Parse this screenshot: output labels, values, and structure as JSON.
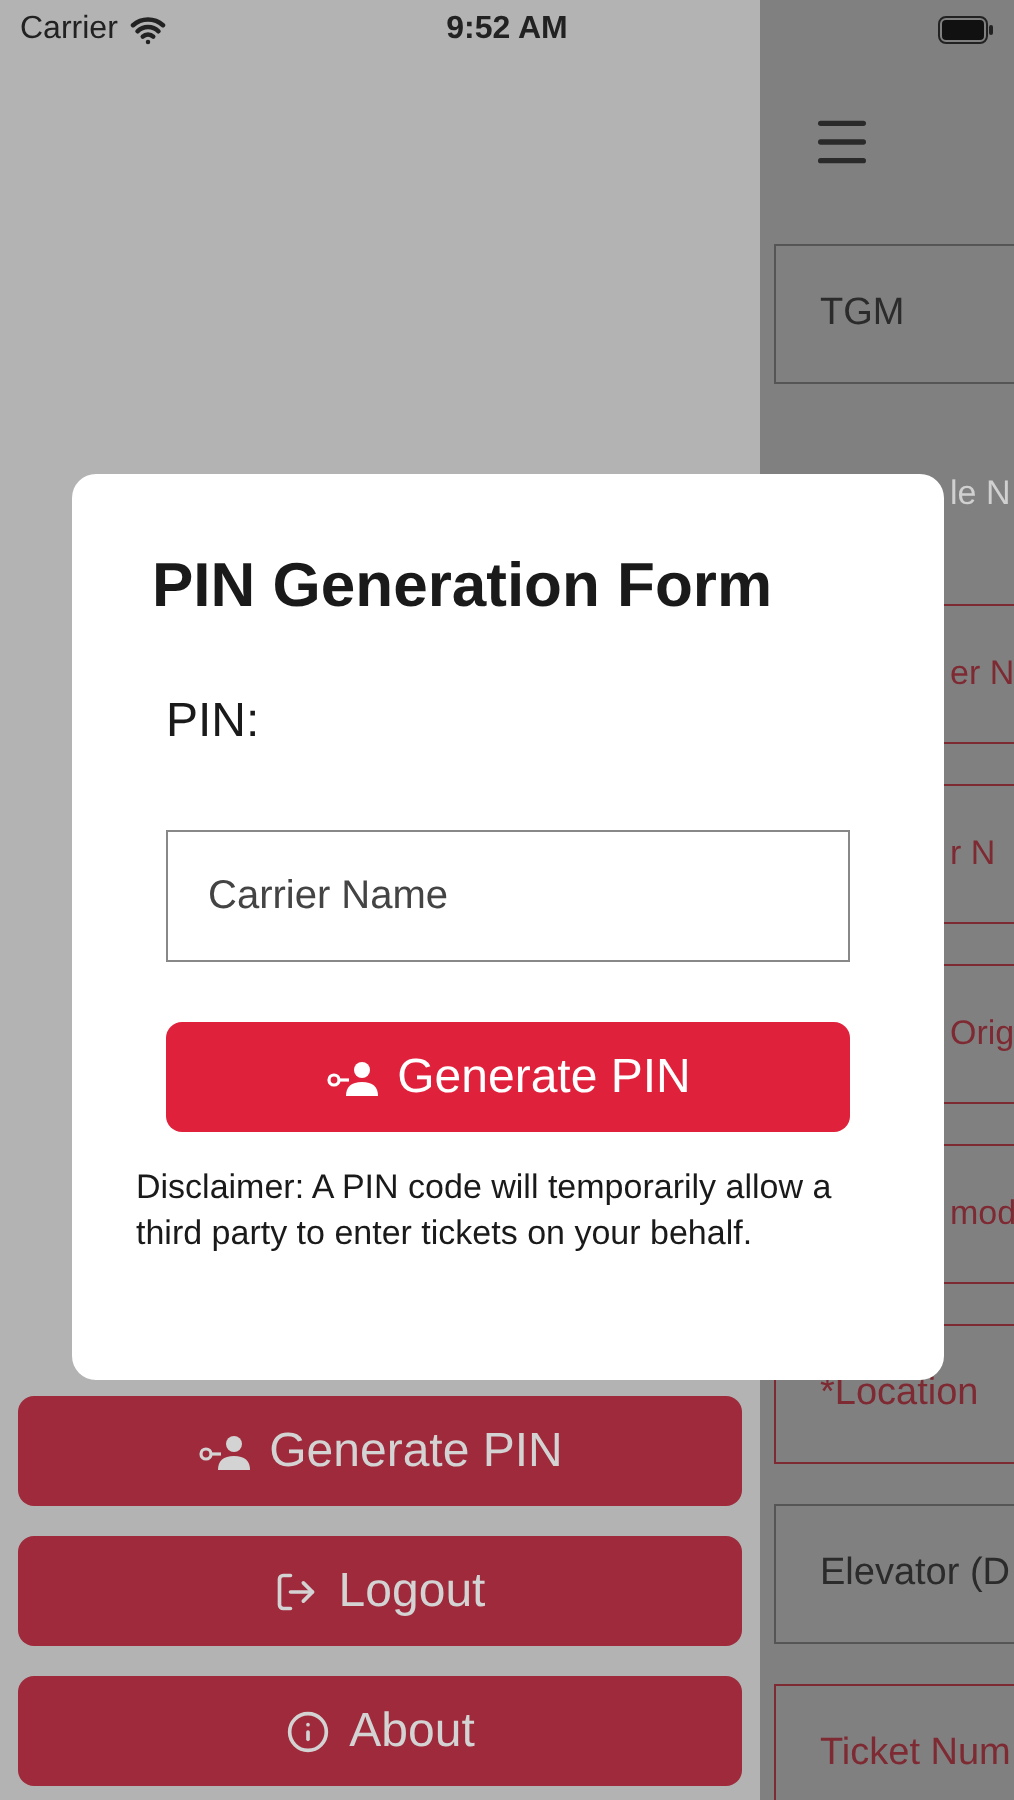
{
  "status_bar": {
    "carrier": "Carrier",
    "time": "9:52 AM"
  },
  "main": {
    "fields": [
      {
        "kind": "box",
        "text": "TGM",
        "partly_hidden": false
      },
      {
        "kind": "hint",
        "text": "le N",
        "partly_hidden": true
      },
      {
        "kind": "required",
        "text": "er N",
        "partly_hidden": true
      },
      {
        "kind": "required",
        "text": "r N",
        "partly_hidden": true
      },
      {
        "kind": "required",
        "text": "Orig",
        "partly_hidden": true
      },
      {
        "kind": "required",
        "text": "mod",
        "partly_hidden": true
      },
      {
        "kind": "required",
        "text": "*Location",
        "partly_hidden": false
      },
      {
        "kind": "box",
        "text": "Elevator (D",
        "partly_hidden": false
      },
      {
        "kind": "required",
        "text": "Ticket Num",
        "partly_hidden": false
      }
    ]
  },
  "drawer": {
    "buttons": [
      {
        "kind": "pin",
        "label": "Generate PIN"
      },
      {
        "kind": "logout",
        "label": "Logout"
      },
      {
        "kind": "about",
        "label": "About"
      }
    ]
  },
  "modal": {
    "title": "PIN Generation Form",
    "pin_label": "PIN:",
    "input": {
      "placeholder": "Carrier Name"
    },
    "button": {
      "kind": "pin",
      "label": "Generate PIN"
    },
    "disclaimer": "Disclaimer: A PIN code will temporarily allow a third party to enter tickets on your behalf."
  }
}
